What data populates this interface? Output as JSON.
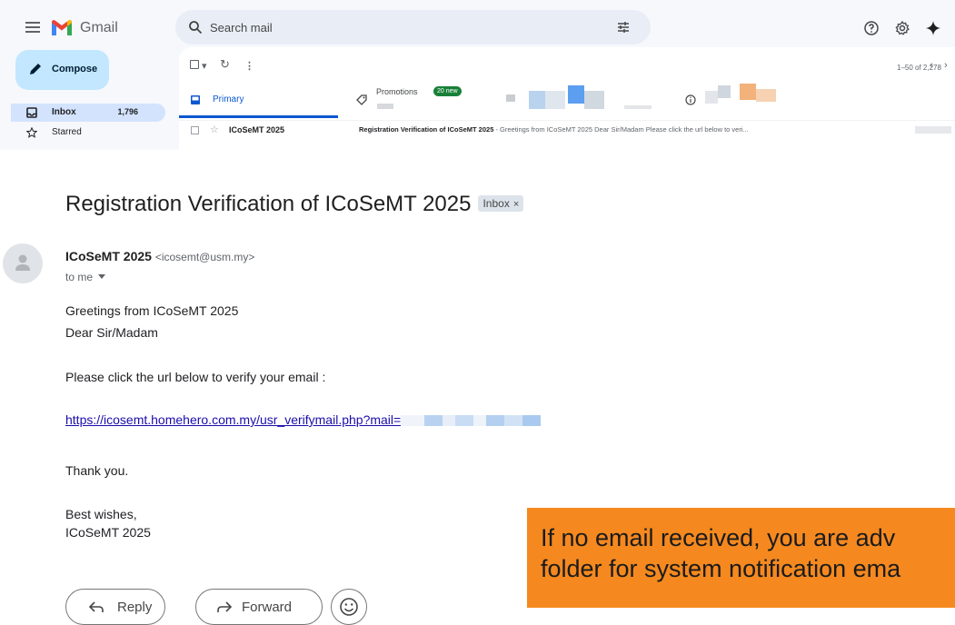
{
  "gmail": {
    "app_name": "Gmail",
    "search_placeholder": "Search mail",
    "compose_label": "Compose",
    "nav": [
      {
        "label": "Inbox",
        "count": "1,796",
        "active": true
      },
      {
        "label": "Starred",
        "count": "",
        "active": false
      }
    ],
    "pagination": "1–50 of 2,278",
    "tabs": {
      "primary": "Primary",
      "promotions": "Promotions",
      "promotions_badge": "20 new"
    },
    "row": {
      "sender": "ICoSeMT 2025",
      "subject": "Registration Verification of ICoSeMT 2025",
      "snippet": " - Greetings from ICoSeMT 2025 Dear Sir/Madam Please click the url below to veri..."
    },
    "colors": {
      "accent": "#0b57d0",
      "compose_bg": "#c2e7ff",
      "badge": "#188038",
      "search_bg": "#e9eef6"
    }
  },
  "email": {
    "subject": "Registration Verification of ICoSeMT 2025",
    "label_chip": "Inbox",
    "chip_close": "×",
    "sender_name": "ICoSeMT 2025",
    "sender_email": "<icosemt@usm.my>",
    "to": "to me",
    "greeting": "Greetings from ICoSeMT 2025",
    "salutation": "Dear Sir/Madam",
    "instruction": "Please click the url below to verify your email :",
    "link": "https://icosemt.homehero.com.my/usr_verifymail.php?mail=",
    "thanks": "Thank you.",
    "closing": "Best wishes,",
    "signature": "ICoSeMT 2025"
  },
  "actions": {
    "reply": "Reply",
    "forward": "Forward"
  },
  "notice": {
    "line1": "If no email received, you are adv",
    "line2": "folder for system notification ema",
    "bg": "#f5891f"
  }
}
